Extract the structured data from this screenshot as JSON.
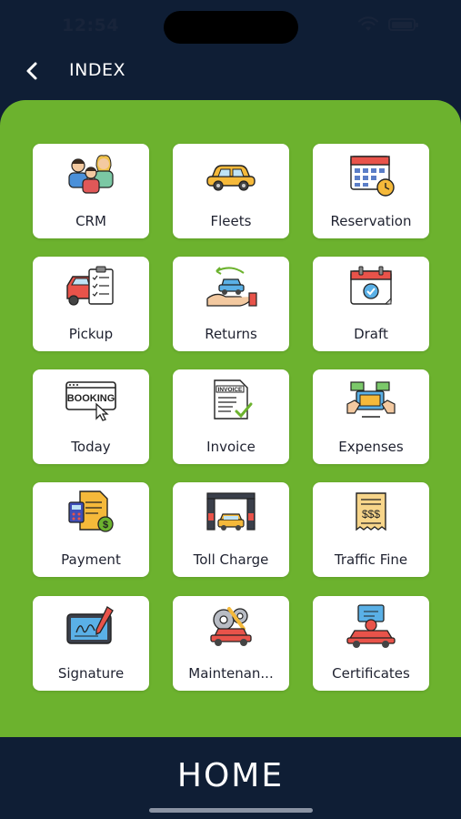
{
  "status": {
    "time": "12:54"
  },
  "header": {
    "title": "INDEX",
    "back_icon": "chevron-left-icon"
  },
  "tiles": [
    {
      "label": "CRM",
      "icon": "people-group-icon"
    },
    {
      "label": "Fleets",
      "icon": "car-icon"
    },
    {
      "label": "Reservation",
      "icon": "calendar-clock-icon"
    },
    {
      "label": "Pickup",
      "icon": "car-checklist-icon"
    },
    {
      "label": "Returns",
      "icon": "car-return-hand-icon"
    },
    {
      "label": "Draft",
      "icon": "calendar-check-icon"
    },
    {
      "label": "Today",
      "icon": "booking-click-icon"
    },
    {
      "label": "Invoice",
      "icon": "invoice-check-icon"
    },
    {
      "label": "Expenses",
      "icon": "money-transfer-icon"
    },
    {
      "label": "Payment",
      "icon": "calculator-coin-icon"
    },
    {
      "label": "Toll Charge",
      "icon": "toll-gate-icon"
    },
    {
      "label": "Traffic Fine",
      "icon": "fine-receipt-icon"
    },
    {
      "label": "Signature",
      "icon": "tablet-pen-icon"
    },
    {
      "label": "Maintenan...",
      "icon": "car-repair-icon"
    },
    {
      "label": "Certificates",
      "icon": "car-certificate-icon"
    }
  ],
  "footer": {
    "title": "HOME"
  },
  "colors": {
    "background": "#0f1e35",
    "panel": "#6cb22e",
    "tile": "#ffffff",
    "text": "#1f2230"
  }
}
